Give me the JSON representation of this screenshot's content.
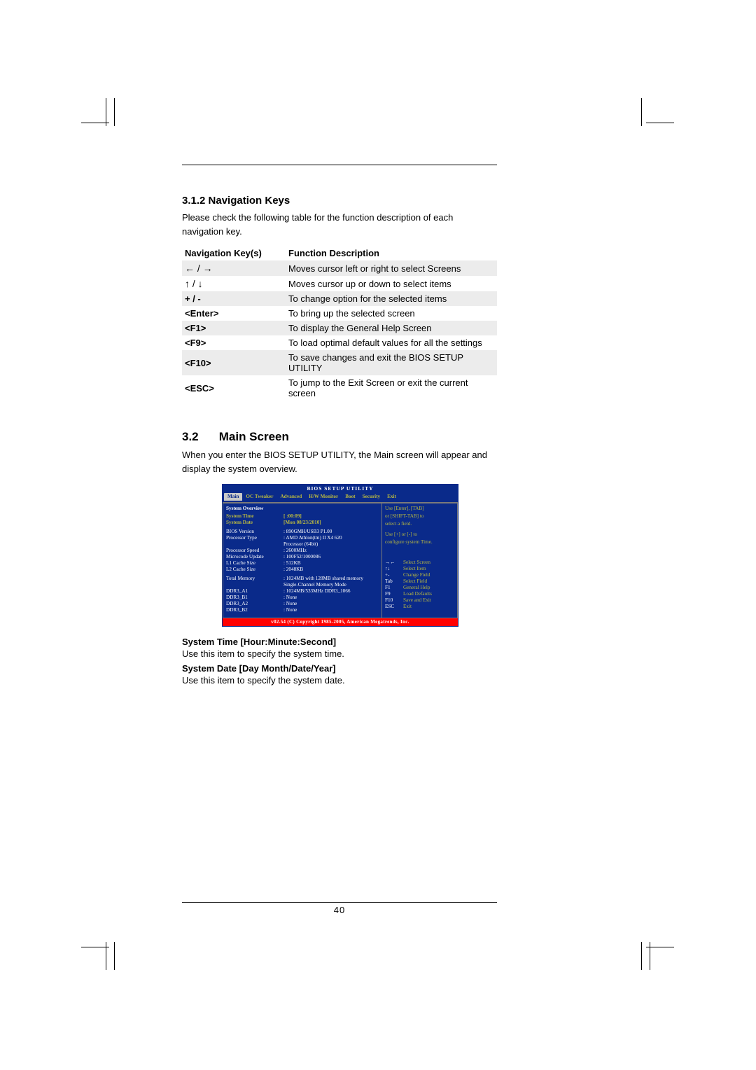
{
  "section1": {
    "heading": "3.1.2 Navigation Keys",
    "intro": "Please check the following table for the function description of each navigation key."
  },
  "navtable": {
    "headers": {
      "keys": "Navigation Key(s)",
      "func": "Function Description"
    },
    "rows": [
      {
        "key_arrows": "← / →",
        "desc": "Moves cursor left or right to select Screens"
      },
      {
        "key_arrows": "↑ / ↓",
        "desc": "Moves cursor up or down to select items"
      },
      {
        "key": "+  /  -",
        "desc": "To change option for the selected items"
      },
      {
        "key": "<Enter>",
        "desc": "To bring up the selected screen"
      },
      {
        "key": "<F1>",
        "desc": "To display the General Help Screen"
      },
      {
        "key": "<F9>",
        "desc": "To load optimal default values for all the settings"
      },
      {
        "key": "<F10>",
        "desc": "To save changes and exit the BIOS SETUP UTILITY"
      },
      {
        "key": "<ESC>",
        "desc": "To jump to the Exit Screen or exit the current screen"
      }
    ]
  },
  "section2": {
    "num": "3.2",
    "title": "Main Screen",
    "intro": "When you enter the BIOS SETUP UTILITY, the Main screen will appear and display the system overview."
  },
  "bios": {
    "title": "BIOS SETUP UTILITY",
    "tabs": [
      "Main",
      "OC Tweaker",
      "Advanced",
      "H/W Monitor",
      "Boot",
      "Security",
      "Exit"
    ],
    "overview_heading": "System Overview",
    "rows": {
      "system_time_label": "System Time",
      "system_time_value": "[  :00:09]",
      "system_date_label": "System Date",
      "system_date_value": "[Mon 08/23/2010]",
      "bios_version_label": "BIOS Version",
      "bios_version_value": ": 890GMH/USB3 P1.00",
      "processor_type_label": "Processor Type",
      "processor_type_value": ": AMD Athlon(tm) II X4 620",
      "processor_type_value2": "  Processor (64bit)",
      "processor_speed_label": "Processor Speed",
      "processor_speed_value": ": 2600MHz",
      "microcode_label": "Microcode Update",
      "microcode_value": ": 100F52/1000086",
      "l1_label": "L1 Cache Size",
      "l1_value": ": 512KB",
      "l2_label": "L2 Cache Size",
      "l2_value": ": 2048KB",
      "total_mem_label": "Total Memory",
      "total_mem_value": ": 1024MB with 128MB shared memory",
      "total_mem_value2": "  Single-Channel Memory Mode",
      "ddr3_a1_label": "  DDR3_A1",
      "ddr3_a1_value": ": 1024MB/533MHz DDR3_1066",
      "ddr3_b1_label": "  DDR3_B1",
      "ddr3_b1_value": ": None",
      "ddr3_a2_label": "  DDR3_A2",
      "ddr3_a2_value": ": None",
      "ddr3_b2_label": "  DDR3_B2",
      "ddr3_b2_value": ": None"
    },
    "right": {
      "hint1": "Use [Enter], [TAB]",
      "hint2": "or [SHIFT-TAB] to",
      "hint3": "select a field.",
      "hint4": "Use [+] or [-] to",
      "hint5": "configure system Time.",
      "keys": [
        {
          "k": "→←",
          "d": "Select Screen"
        },
        {
          "k": "↑↓",
          "d": "Select Item"
        },
        {
          "k": "+-",
          "d": "Change Field"
        },
        {
          "k": "Tab",
          "d": "Select Field"
        },
        {
          "k": "F1",
          "d": "General Help"
        },
        {
          "k": "F9",
          "d": "Load Defaults"
        },
        {
          "k": "F10",
          "d": "Save and Exit"
        },
        {
          "k": "ESC",
          "d": "Exit"
        }
      ]
    },
    "footer": "v02.54 (C) Copyright 1985-2005, American Megatrends, Inc."
  },
  "after": {
    "time_label": "System Time [Hour:Minute:Second]",
    "time_desc": "Use this item to specify the system time.",
    "date_label": "System Date [Day Month/Date/Year]",
    "date_desc": "Use this item to specify the system date."
  },
  "page_number": "40"
}
